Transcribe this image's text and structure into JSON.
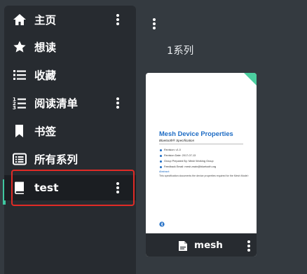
{
  "sidebar": {
    "items": [
      {
        "label": "主页",
        "icon": "home-icon",
        "has_more": true,
        "active": false
      },
      {
        "label": "想读",
        "icon": "star-icon",
        "has_more": false,
        "active": false
      },
      {
        "label": "收藏",
        "icon": "list-icon",
        "has_more": false,
        "active": false
      },
      {
        "label": "阅读清单",
        "icon": "numbered-list-icon",
        "has_more": true,
        "active": false
      },
      {
        "label": "书签",
        "icon": "bookmark-icon",
        "has_more": false,
        "active": false
      },
      {
        "label": "所有系列",
        "icon": "series-list-icon",
        "has_more": false,
        "active": false
      },
      {
        "label": "test",
        "icon": "book-icon",
        "has_more": true,
        "active": true
      }
    ]
  },
  "main": {
    "series_count": "1系列",
    "book": {
      "title": "mesh",
      "file_icon": "pdf-file-icon",
      "cover": {
        "title": "Mesh Device Properties",
        "subtitle": "Bluetooth® Specification",
        "bullets": [
          "Revision: v1.0",
          "Revision Date: 2017-07-13",
          "Group Prepared By: Mesh Working Group",
          "Feedback Email: mesh-main@bluetooth.org"
        ],
        "abstract_label": "Abstract:",
        "abstract": "This specification documents the device properties required for the Mesh Model specification."
      }
    }
  },
  "colors": {
    "sidebar_bg": "#272b30",
    "page_bg": "#343a40",
    "active_accent": "#3fc7a0",
    "highlight": "#e02b26",
    "cover_title": "#1e6cc4"
  }
}
